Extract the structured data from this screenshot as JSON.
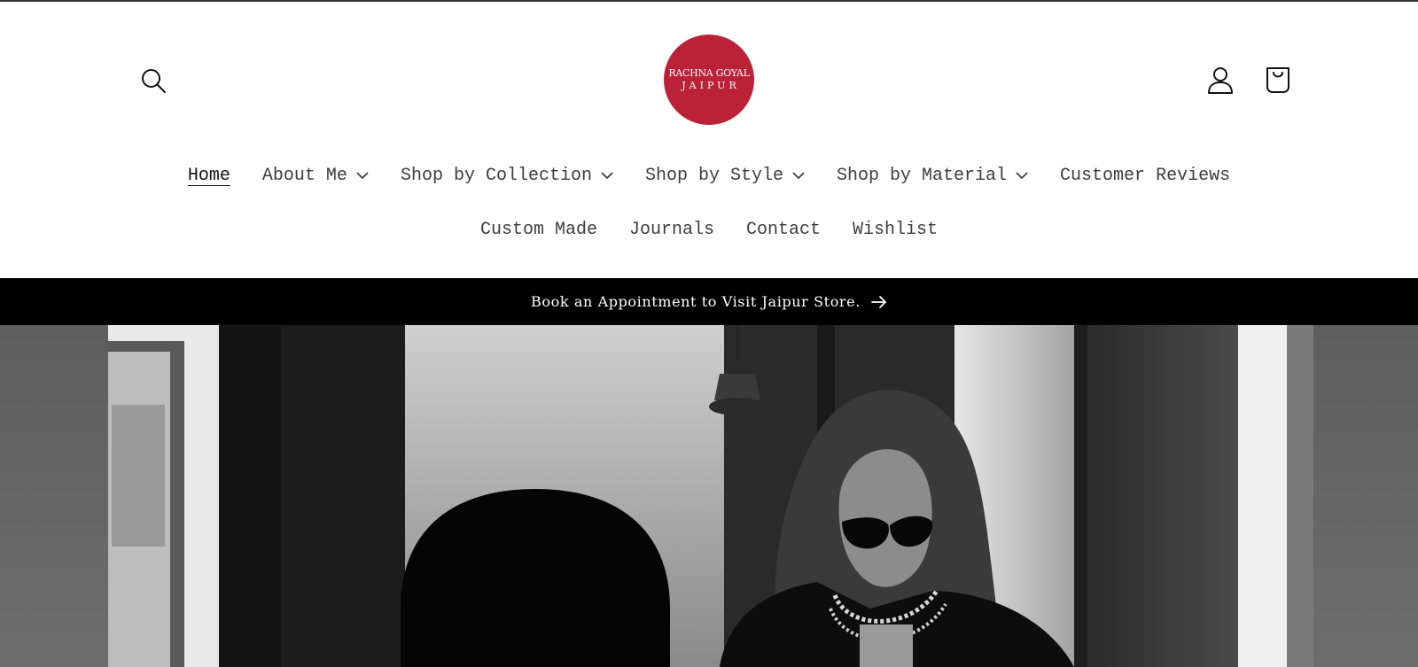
{
  "header": {
    "logo": {
      "line1": "RACHNA GOYAL",
      "line2": "JAIPUR",
      "color": "#bb2238"
    },
    "icons": {
      "search": "search-icon",
      "account": "user-icon",
      "cart": "shopping-bag-icon"
    }
  },
  "nav": {
    "row1": [
      {
        "label": "Home",
        "active": true,
        "dropdown": false
      },
      {
        "label": "About Me",
        "dropdown": true
      },
      {
        "label": "Shop by Collection",
        "dropdown": true
      },
      {
        "label": "Shop by Style",
        "dropdown": true
      },
      {
        "label": "Shop by Material",
        "dropdown": true
      },
      {
        "label": "Customer Reviews",
        "dropdown": false
      }
    ],
    "row2": [
      {
        "label": "Custom Made"
      },
      {
        "label": "Journals"
      },
      {
        "label": "Contact"
      },
      {
        "label": "Wishlist"
      }
    ]
  },
  "announcement": {
    "text": "Book an Appointment to Visit Jaipur Store.",
    "icon": "arrow-right-icon"
  },
  "colors": {
    "text": "#3d3d3d",
    "announcement_bg": "#000000",
    "brand": "#bb2238"
  }
}
